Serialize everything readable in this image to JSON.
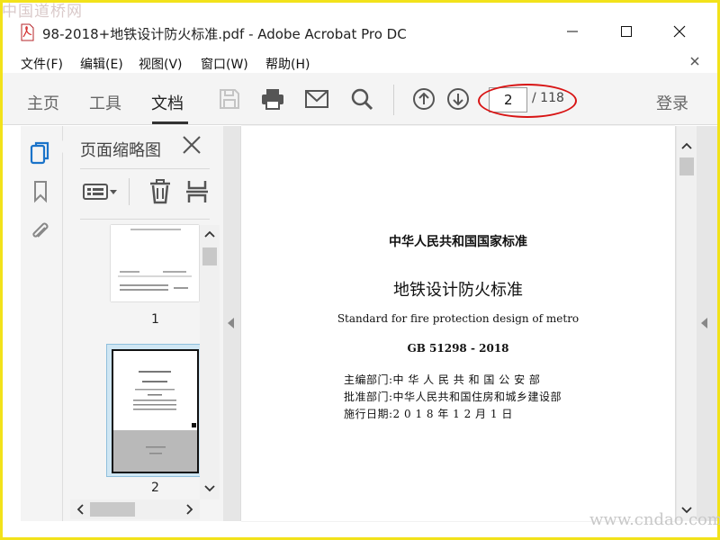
{
  "watermarks": {
    "top_left": "中国道桥网",
    "bottom_right": "www.cndao.com"
  },
  "window": {
    "title": "98-2018+地铁设计防火标准.pdf - Adobe Acrobat Pro DC"
  },
  "menu": {
    "items": [
      "文件(F)",
      "编辑(E)",
      "视图(V)",
      "窗口(W)",
      "帮助(H)"
    ]
  },
  "toolbar": {
    "tabs": [
      {
        "label": "主页",
        "active": false
      },
      {
        "label": "工具",
        "active": false
      },
      {
        "label": "文档",
        "active": true
      }
    ],
    "page_current": "2",
    "page_total": "/ 118",
    "sign_in": "登录"
  },
  "panel": {
    "title": "页面缩略图",
    "thumbnails": [
      {
        "label": "1",
        "selected": false
      },
      {
        "label": "2",
        "selected": true
      }
    ]
  },
  "document": {
    "national_standard": "中华人民共和国国家标准",
    "title": "地铁设计防火标准",
    "title_en": "Standard for fire protection design of metro",
    "code": "GB 51298 - 2018",
    "editor_label": "主编部门:",
    "editor": "中 华 人 民 共 和 国 公 安 部",
    "approver_label": "批准部门:",
    "approver": "中华人民共和国住房和城乡建设部",
    "effective_label": "施行日期:",
    "effective": "2 0 1 8 年 1 2 月 1 日"
  },
  "colors": {
    "accent": "#d81414",
    "frame": "#f2e21a",
    "rail_active": "#1a73c9"
  }
}
